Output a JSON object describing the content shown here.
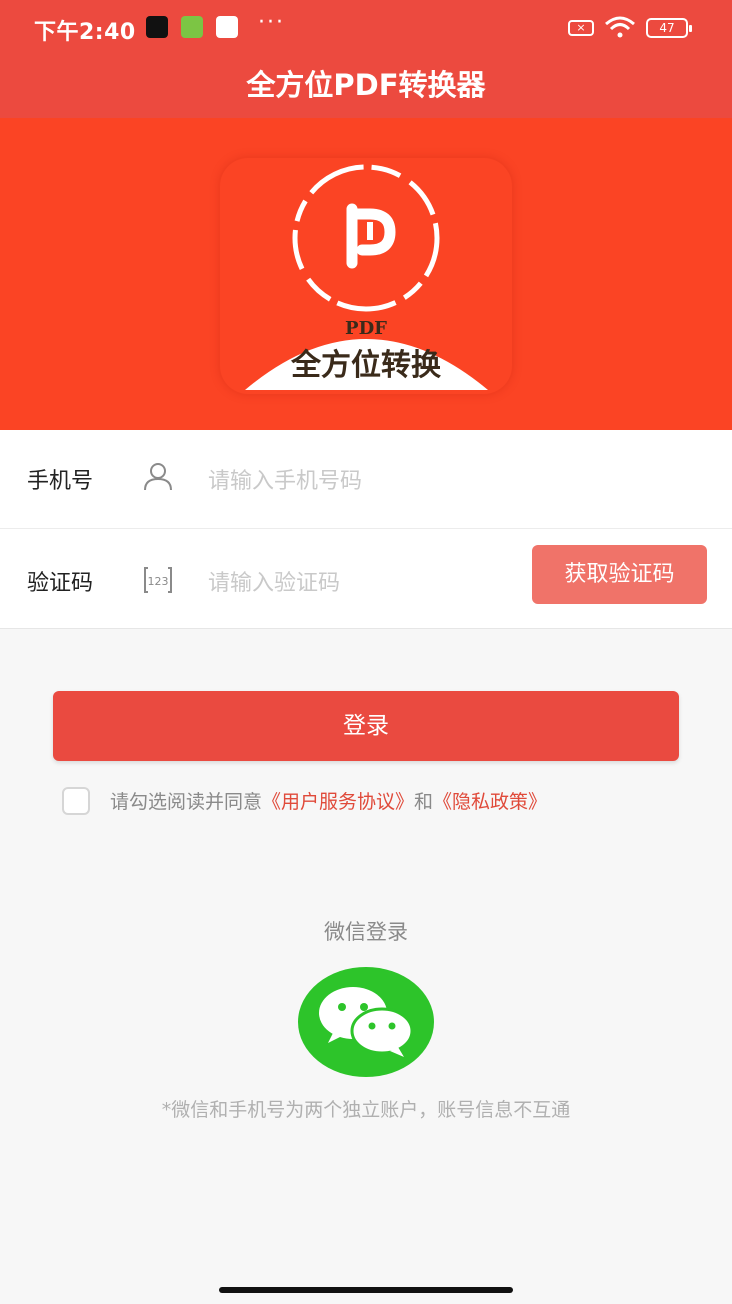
{
  "status_bar": {
    "time": "下午2:40",
    "more": "···",
    "battery": "47"
  },
  "app": {
    "title": "全方位PDF转换器"
  },
  "logo": {
    "letter": "P",
    "small_text": "PDF",
    "main_text": "全方位转换"
  },
  "form": {
    "phone": {
      "label": "手机号",
      "placeholder": "请输入手机号码"
    },
    "code": {
      "label": "验证码",
      "placeholder": "请输入验证码",
      "icon_text": "123",
      "button": "获取验证码"
    }
  },
  "login": {
    "button": "登录"
  },
  "agreement": {
    "prefix": "请勾选阅读并同意",
    "terms": "《用户服务协议》",
    "and": "和",
    "privacy": "《隐私政策》"
  },
  "wechat": {
    "title": "微信登录",
    "note": "*微信和手机号为两个独立账户，账号信息不互通"
  },
  "colors": {
    "header": "#ec4a3f",
    "banner": "#fb4424",
    "button": "#ea4a40",
    "code_button": "#f07369",
    "wechat": "#2dc42a",
    "link": "#e04a3a"
  }
}
